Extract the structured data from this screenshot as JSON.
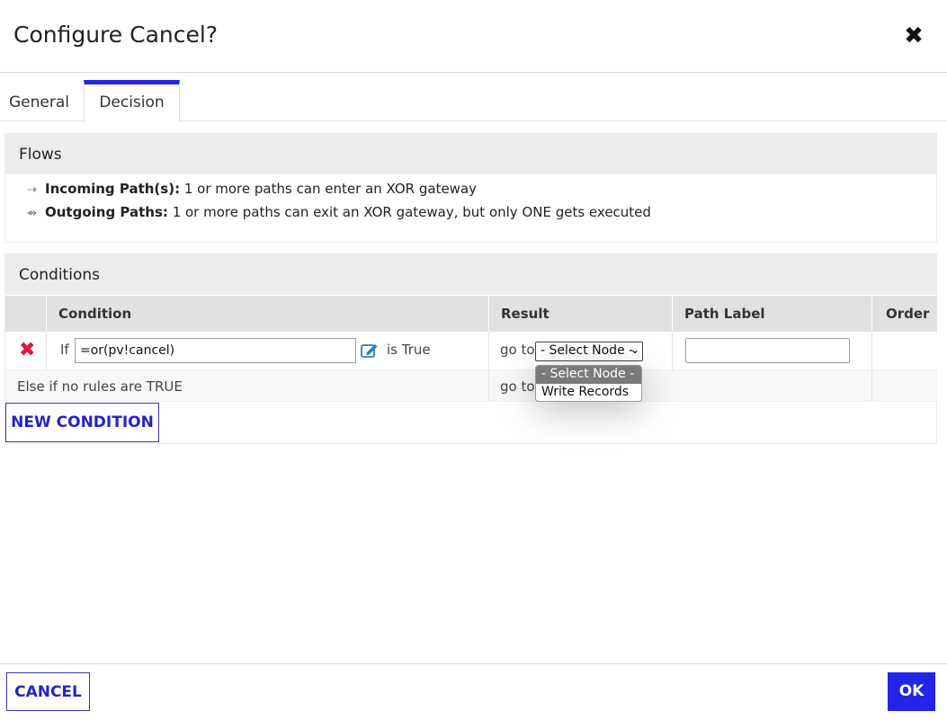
{
  "dialog": {
    "title": "Configure Cancel?"
  },
  "tabs": [
    {
      "label": "General",
      "active": false
    },
    {
      "label": "Decision",
      "active": true
    }
  ],
  "flows": {
    "heading": "Flows",
    "incoming": {
      "label": "Incoming Path(s):",
      "text": " 1 or more paths can enter an XOR gateway",
      "icon": "incoming-arrow-icon"
    },
    "outgoing": {
      "label": "Outgoing Paths:",
      "text": " 1 or more paths can exit an XOR gateway, but only ONE gets executed",
      "icon": "outgoing-arrow-icon"
    }
  },
  "conditions": {
    "heading": "Conditions",
    "columns": [
      "Condition",
      "Result",
      "Path Label",
      "Order"
    ],
    "rows": [
      {
        "if_label": "If",
        "condition_value": "=or(pv!cancel)",
        "is_true": "is True",
        "goto": "go to",
        "select_value": "- Select Node -",
        "path_label": ""
      }
    ],
    "else_row": {
      "text": "Else if no rules are TRUE",
      "goto": "go to"
    },
    "new_condition_label": "NEW CONDITION"
  },
  "dropdown": {
    "options": [
      "- Select Node -",
      "Write Records"
    ],
    "selected_index": 0
  },
  "footer": {
    "cancel_label": "CANCEL",
    "ok_label": "OK"
  },
  "colors": {
    "accent": "#2424e6",
    "delete": "#e0163e",
    "header_bg": "#ececec"
  }
}
